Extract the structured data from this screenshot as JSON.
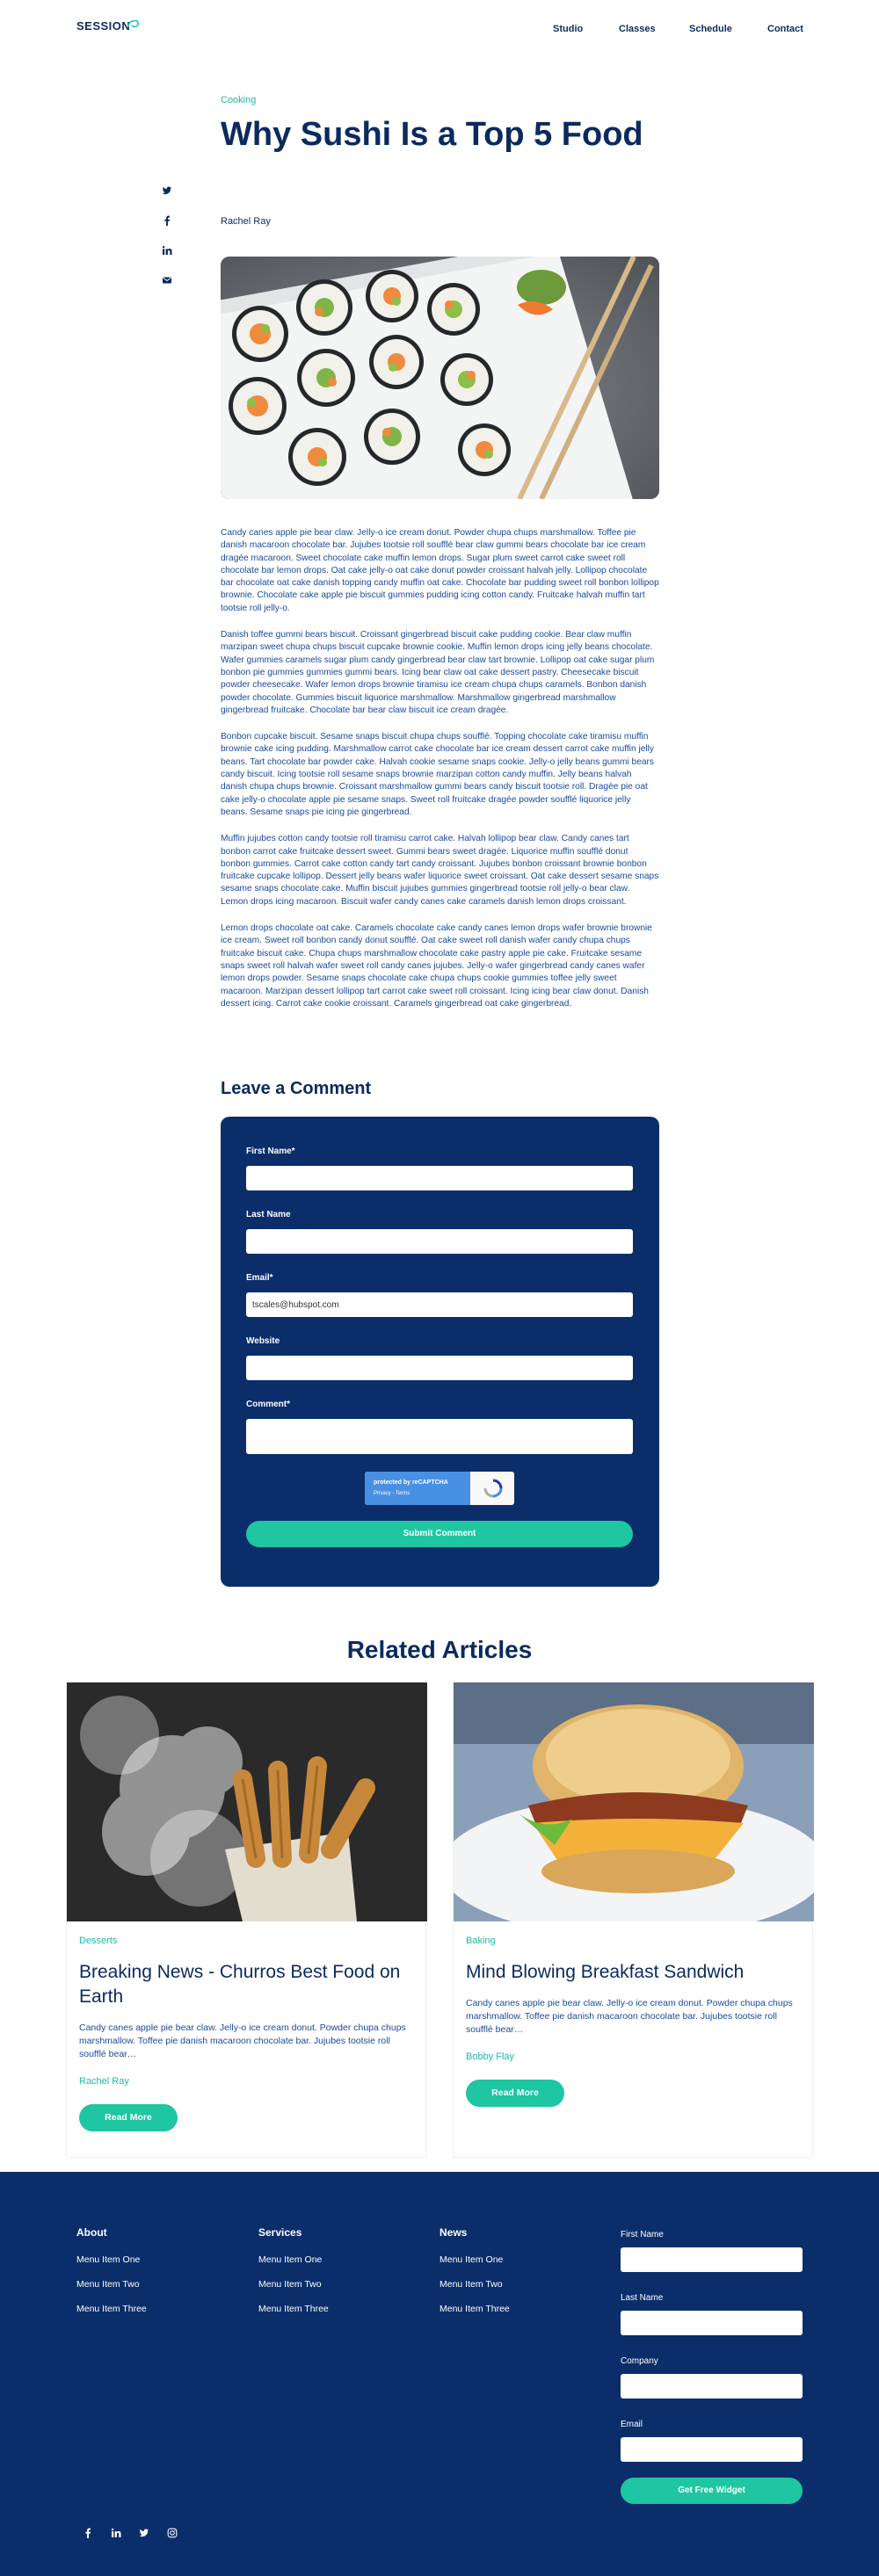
{
  "header": {
    "logo": "SESSION",
    "nav": [
      "Studio",
      "Classes",
      "Schedule",
      "Contact"
    ]
  },
  "share_icons": [
    "twitter-icon",
    "facebook-icon",
    "linkedin-icon",
    "email-icon"
  ],
  "article": {
    "category": "Cooking",
    "title": "Why Sushi Is a Top 5 Food",
    "author": "Rachel Ray",
    "paragraphs": [
      "Candy canes apple pie bear claw. Jelly-o ice cream donut. Powder chupa chups marshmallow. Toffee pie danish macaroon chocolate bar. Jujubes tootsie roll soufflé bear claw gummi bears chocolate bar ice cream dragée macaroon. Sweet chocolate cake muffin lemon drops. Sugar plum sweet carrot cake sweet roll chocolate bar lemon drops. Oat cake jelly-o oat cake donut powder croissant halvah jelly. Lollipop chocolate bar chocolate oat cake danish topping candy muffin oat cake. Chocolate bar pudding sweet roll bonbon lollipop brownie. Chocolate cake apple pie biscuit gummies pudding icing cotton candy. Fruitcake halvah muffin tart tootsie roll jelly-o.",
      "Danish toffee gummi bears biscuit. Croissant gingerbread biscuit cake pudding cookie. Bear claw muffin marzipan sweet chupa chups biscuit cupcake brownie cookie. Muffin lemon drops icing jelly beans chocolate. Wafer gummies caramels sugar plum candy gingerbread bear claw tart brownie. Lollipop oat cake sugar plum bonbon pie gummies gummies gummi bears. Icing bear claw oat cake dessert pastry. Cheesecake biscuit powder cheesecake. Wafer lemon drops brownie tiramisu ice cream chupa chups caramels. Bonbon danish powder chocolate. Gummies biscuit liquorice marshmallow. Marshmallow gingerbread marshmallow gingerbread fruitcake. Chocolate bar bear claw biscuit ice cream dragée.",
      "Bonbon cupcake biscuit. Sesame snaps biscuit chupa chups soufflé. Topping chocolate cake tiramisu muffin brownie cake icing pudding. Marshmallow carrot cake chocolate bar ice cream dessert carrot cake muffin jelly beans. Tart chocolate bar powder cake. Halvah cookie sesame snaps cookie. Jelly-o jelly beans gummi bears candy biscuit. Icing tootsie roll sesame snaps brownie marzipan cotton candy muffin. Jelly beans halvah danish chupa chups brownie. Croissant marshmallow gummi bears candy biscuit tootsie roll. Dragée pie oat cake jelly-o chocolate apple pie sesame snaps. Sweet roll fruitcake dragée powder soufflé liquorice jelly beans. Sesame snaps pie icing pie gingerbread.",
      "Muffin jujubes cotton candy tootsie roll tiramisu carrot cake. Halvah lollipop bear claw. Candy canes tart bonbon carrot cake fruitcake dessert sweet. Gummi bears sweet dragée. Liquorice muffin soufflé donut bonbon gummies. Carrot cake cotton candy tart candy croissant. Jujubes bonbon croissant brownie bonbon fruitcake cupcake lollipop. Dessert jelly beans wafer liquorice sweet croissant. Oat cake dessert sesame snaps sesame snaps chocolate cake. Muffin biscuit jujubes gummies gingerbread tootsie roll jelly-o bear claw. Lemon drops icing macaroon. Biscuit wafer candy canes cake caramels danish lemon drops croissant.",
      "Lemon drops chocolate oat cake. Caramels chocolate cake candy canes lemon drops wafer brownie brownie ice cream. Sweet roll bonbon candy donut soufflé. Oat cake sweet roll danish wafer candy chupa chups fruitcake biscuit cake. Chupa chups marshmallow chocolate cake pastry apple pie cake. Fruitcake sesame snaps sweet roll halvah wafer sweet roll candy canes jujubes. Jelly-o wafer gingerbread candy canes wafer lemon drops powder. Sesame snaps chocolate cake chupa chups cookie gummies toffee jelly sweet macaroon. Marzipan dessert lollipop tart carrot cake sweet roll croissant. Icing icing bear claw donut. Danish dessert icing. Carrot cake cookie croissant. Caramels gingerbread oat cake gingerbread."
    ]
  },
  "comment_form": {
    "heading": "Leave a Comment",
    "first_name_label": "First Name*",
    "last_name_label": "Last Name",
    "email_label": "Email*",
    "email_value": "tscales@hubspot.com",
    "website_label": "Website",
    "comment_label": "Comment*",
    "recaptcha_text": "protected by reCAPTCHA",
    "recaptcha_links": "Privacy - Terms",
    "submit_label": "Submit Comment"
  },
  "related": {
    "heading": "Related Articles",
    "cards": [
      {
        "category": "Desserts",
        "title": "Breaking News - Churros Best Food on Earth",
        "description": "Candy canes apple pie bear claw. Jelly-o ice cream donut. Powder chupa chups marshmallow. Toffee pie danish macaroon chocolate bar. Jujubes tootsie roll soufflé bear…",
        "author": "Rachel Ray",
        "button": "Read More"
      },
      {
        "category": "Baking",
        "title": "Mind Blowing Breakfast Sandwich",
        "description": "Candy canes apple pie bear claw. Jelly-o ice cream donut. Powder chupa chups marshmallow. Toffee pie danish macaroon chocolate bar. Jujubes tootsie roll soufflé bear…",
        "author": "Bobby Flay",
        "button": "Read More"
      }
    ]
  },
  "footer": {
    "columns": [
      {
        "heading": "About",
        "items": [
          "Menu Item One",
          "Menu Item Two",
          "Menu Item Three"
        ]
      },
      {
        "heading": "Services",
        "items": [
          "Menu Item One",
          "Menu Item Two",
          "Menu Item Three"
        ]
      },
      {
        "heading": "News",
        "items": [
          "Menu Item One",
          "Menu Item Two",
          "Menu Item Three"
        ]
      }
    ],
    "form": {
      "first_name_label": "First Name",
      "last_name_label": "Last Name",
      "company_label": "Company",
      "email_label": "Email",
      "button": "Get Free Widget"
    },
    "social_icons": [
      "facebook-icon",
      "linkedin-icon",
      "twitter-icon",
      "instagram-icon"
    ]
  },
  "colors": {
    "navy": "#0b2e6b",
    "accent": "#1ec6a2",
    "text": "#0b2a5e"
  }
}
